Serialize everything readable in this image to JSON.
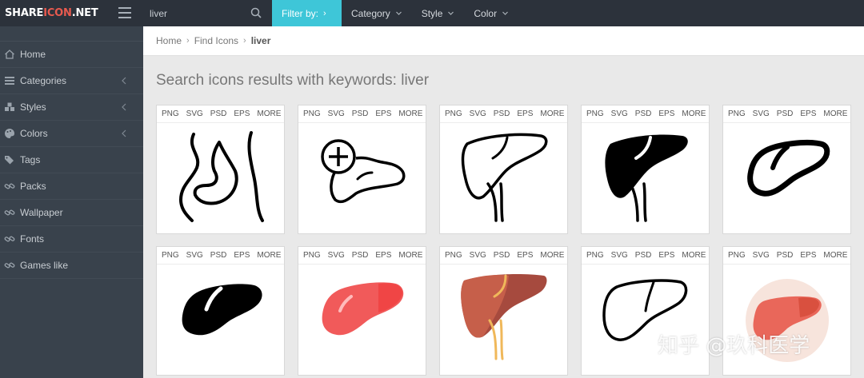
{
  "brand": {
    "part1": "SHARE",
    "part2": "ICON",
    "part3": ".NET"
  },
  "search": {
    "value": "liver"
  },
  "topnav": {
    "filter_label": "Filter by:",
    "dropdowns": [
      {
        "label": "Category"
      },
      {
        "label": "Style"
      },
      {
        "label": "Color"
      }
    ]
  },
  "sidebar": {
    "items": [
      {
        "label": "Home",
        "icon": "home-icon"
      },
      {
        "label": "Categories",
        "icon": "list-icon",
        "has_arrow": true
      },
      {
        "label": "Styles",
        "icon": "cubes-icon",
        "has_arrow": true
      },
      {
        "label": "Colors",
        "icon": "palette-icon",
        "has_arrow": true
      },
      {
        "label": "Tags",
        "icon": "tags-icon"
      },
      {
        "label": "Packs",
        "icon": "link-icon"
      },
      {
        "label": "Wallpaper",
        "icon": "link-icon"
      },
      {
        "label": "Fonts",
        "icon": "link-icon"
      },
      {
        "label": "Games like",
        "icon": "link-icon"
      }
    ]
  },
  "breadcrumb": {
    "home": "Home",
    "find": "Find Icons",
    "current": "liver"
  },
  "page_title": "Search icons results with keywords: liver",
  "formats": [
    "PNG",
    "SVG",
    "PSD",
    "EPS",
    "MORE"
  ],
  "icons": [
    {
      "name": "stomach-body-outline-icon"
    },
    {
      "name": "liver-plus-outline-icon"
    },
    {
      "name": "liver-detailed-outline-icon"
    },
    {
      "name": "liver-solid-black-icon"
    },
    {
      "name": "liver-bold-outline-icon"
    },
    {
      "name": "liver-glyph-black-icon"
    },
    {
      "name": "liver-flat-red-icon"
    },
    {
      "name": "liver-flat-brown-icon"
    },
    {
      "name": "liver-thin-outline-icon"
    },
    {
      "name": "liver-circle-red-icon"
    }
  ],
  "colors": {
    "accent": "#3ec6d8",
    "topbar": "#2c323b",
    "sidebar": "#39424c",
    "logo_accent": "#e85a4f"
  },
  "watermark": "知乎 @玖科医学"
}
